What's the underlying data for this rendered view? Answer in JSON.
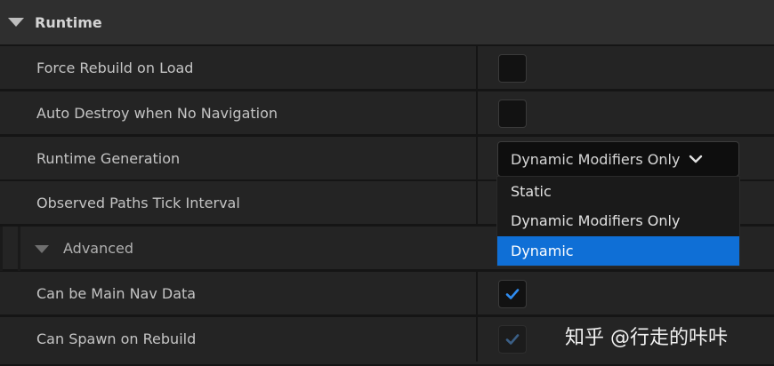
{
  "section": {
    "title": "Runtime"
  },
  "rows": [
    {
      "label": "Force Rebuild on Load",
      "checked": false
    },
    {
      "label": "Auto Destroy when No Navigation",
      "checked": false
    },
    {
      "label": "Runtime Generation"
    },
    {
      "label": "Observed Paths Tick Interval"
    },
    {
      "label": "Advanced"
    },
    {
      "label": "Can be Main Nav Data",
      "checked": true
    },
    {
      "label": "Can Spawn on Rebuild",
      "checked": true
    }
  ],
  "runtime_generation": {
    "selected": "Dynamic Modifiers Only",
    "options": [
      "Static",
      "Dynamic Modifiers Only",
      "Dynamic"
    ],
    "highlighted": "Dynamic"
  },
  "colors": {
    "accent": "#0f6fd6",
    "check": "#2f8cf0",
    "check_disabled": "#3b5f86"
  },
  "watermark": "知乎 @行走的咔咔"
}
